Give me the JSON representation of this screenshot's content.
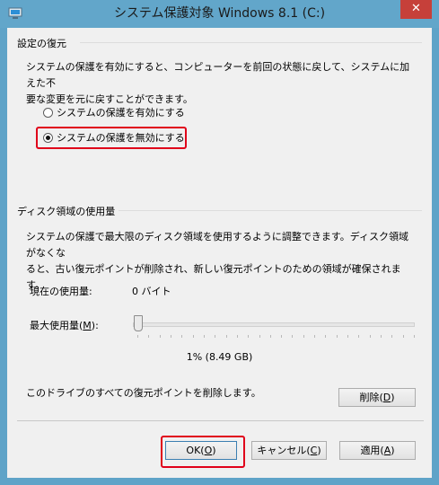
{
  "window": {
    "title": "システム保護対象 Windows 8.1 (C:)",
    "close_label": "✕"
  },
  "restore": {
    "group_label": "設定の復元",
    "description_line1": "システムの保護を有効にすると、コンピューターを前回の状態に戻して、システムに加えた不",
    "description_line2": "要な変更を元に戻すことができます。",
    "option_enable": "システムの保護を有効にする",
    "option_disable": "システムの保護を無効にする",
    "selected": "option_disable"
  },
  "disk": {
    "group_label": "ディスク領域の使用量",
    "description_line1": "システムの保護で最大限のディスク領域を使用するように調整できます。ディスク領域がなくな",
    "description_line2": "ると、古い復元ポイントが削除され、新しい復元ポイントのための領域が確保されます。",
    "current_usage_label": "現在の使用量:",
    "current_usage_value": "0 バイト",
    "max_usage_label_pre": "最大使用量(",
    "max_usage_label_key": "M",
    "max_usage_label_post": "):",
    "max_usage_percent": 1,
    "max_usage_value": "1% (8.49 GB)",
    "delete_text": "このドライブのすべての復元ポイントを削除します。",
    "delete_button_pre": "削除(",
    "delete_button_key": "D",
    "delete_button_post": ")"
  },
  "footer": {
    "ok_pre": "OK(",
    "ok_key": "O",
    "ok_post": ")",
    "cancel_pre": "キャンセル(",
    "cancel_key": "C",
    "cancel_post": ")",
    "apply_pre": "適用(",
    "apply_key": "A",
    "apply_post": ")"
  },
  "colors": {
    "titlebar": "#62a6ca",
    "close": "#c6403a",
    "highlight": "#e0001a"
  }
}
